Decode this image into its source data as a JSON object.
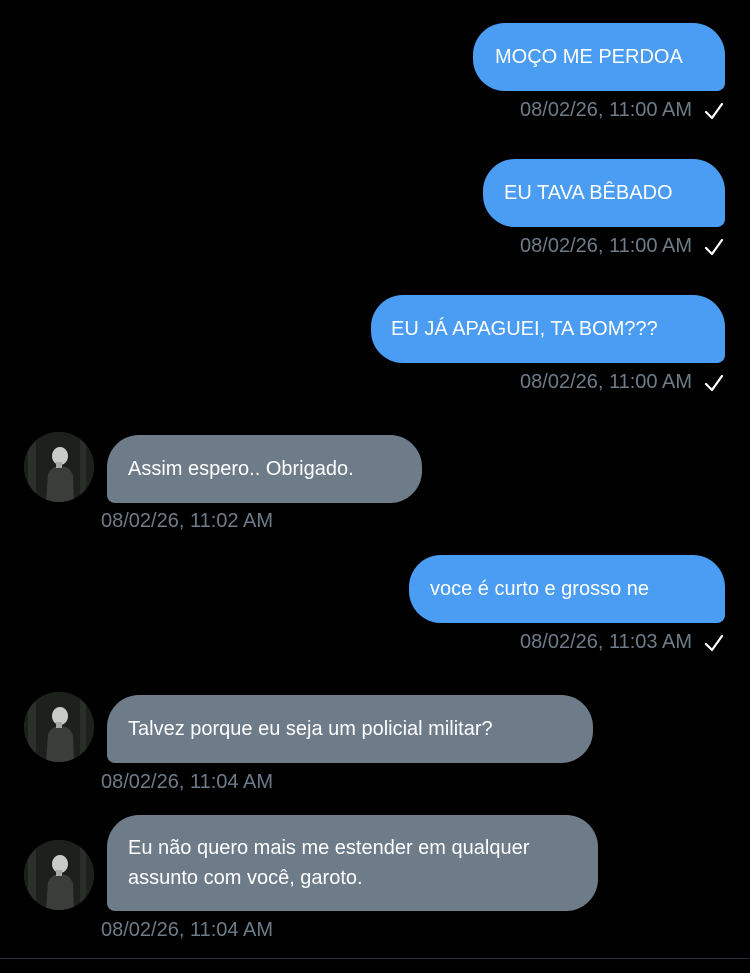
{
  "conversation": {
    "messages": [
      {
        "direction": "sent",
        "text": "MOÇO ME PERDOA",
        "timestamp": "08/02/26, 11:00 AM",
        "status": "check-icon"
      },
      {
        "direction": "sent",
        "text": "EU TAVA BÊBADO",
        "timestamp": "08/02/26, 11:00 AM",
        "status": "check-icon"
      },
      {
        "direction": "sent",
        "text": "EU JÁ APAGUEI, TA BOM???",
        "timestamp": "08/02/26, 11:00 AM",
        "status": "check-icon"
      },
      {
        "direction": "received",
        "text": "Assim espero.. Obrigado.",
        "timestamp": "08/02/26, 11:02 AM"
      },
      {
        "direction": "sent",
        "text": "voce é curto e grosso ne",
        "timestamp": "08/02/26, 11:03 AM",
        "status": "check-icon"
      },
      {
        "direction": "received",
        "text": "Talvez porque eu seja um policial militar?",
        "timestamp": "08/02/26, 11:04 AM"
      },
      {
        "direction": "received",
        "text": "Eu não quero mais me estender em qualquer assunto com você, garoto.",
        "timestamp": "08/02/26, 11:04 AM"
      }
    ]
  },
  "colors": {
    "background": "#000000",
    "sent_bubble": "#4a9df2",
    "received_bubble": "#6e7b89",
    "timestamp": "#6e7b89",
    "check": "#ffffff"
  }
}
